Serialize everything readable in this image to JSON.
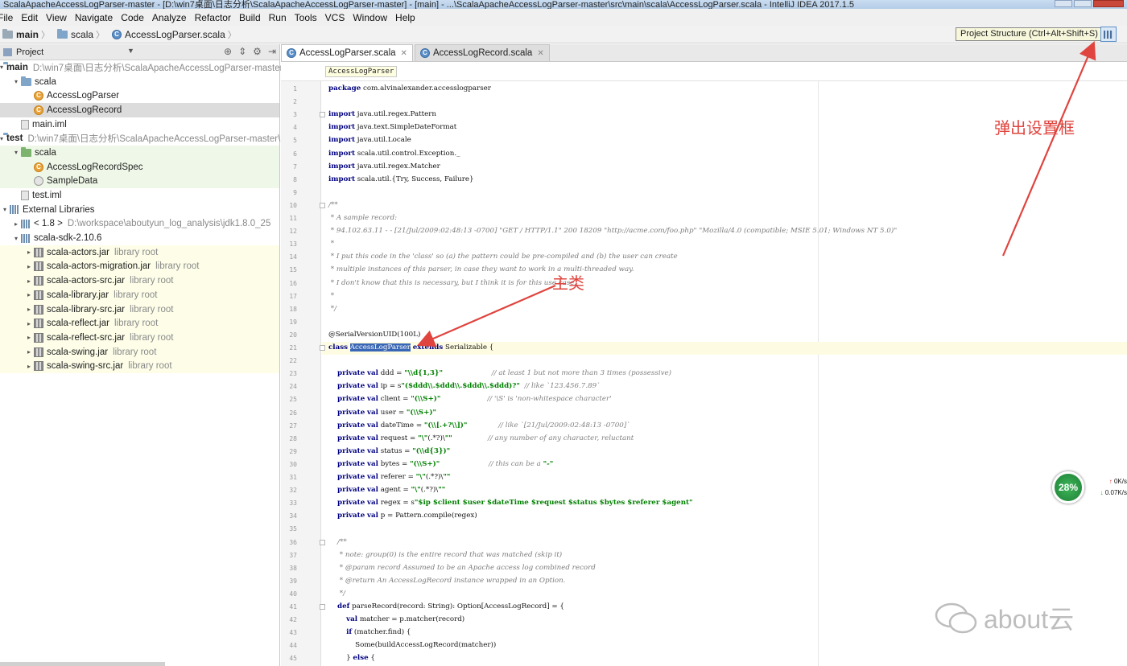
{
  "window": {
    "title": "ScalaApacheAccessLogParser-master - [D:\\win7桌面\\日志分析\\ScalaApacheAccessLogParser-master] - [main] - ...\\ScalaApacheAccessLogParser-master\\src\\main\\scala\\AccessLogParser.scala - IntelliJ IDEA 2017.1.5"
  },
  "menu": [
    "File",
    "Edit",
    "View",
    "Navigate",
    "Code",
    "Analyze",
    "Refactor",
    "Build",
    "Run",
    "Tools",
    "VCS",
    "Window",
    "Help"
  ],
  "nav": {
    "crumbs": [
      "main",
      "scala",
      "AccessLogParser.scala"
    ],
    "tooltip": "Project Structure (Ctrl+Alt+Shift+S)"
  },
  "project_panel": {
    "title": "Project",
    "tree": [
      {
        "label": "main",
        "hint": "D:\\win7桌面\\日志分析\\ScalaApacheAccessLogParser-master",
        "icon": "folder-icon",
        "bold": true,
        "arrow": "▾",
        "bg": ""
      },
      {
        "label": "scala",
        "hint": "",
        "icon": "folder-icon",
        "arrow": "▾",
        "bg": ""
      },
      {
        "label": "AccessLogParser",
        "hint": "",
        "icon": "scala-class-icon",
        "arrow": "",
        "bg": ""
      },
      {
        "label": "AccessLogRecord",
        "hint": "",
        "icon": "scala-class-icon",
        "arrow": "",
        "bg": "selected"
      },
      {
        "label": "main.iml",
        "hint": "",
        "icon": "iml-file-icon",
        "arrow": "",
        "bg": ""
      },
      {
        "label": "test",
        "hint": "D:\\win7桌面\\日志分析\\ScalaApacheAccessLogParser-master\\",
        "icon": "folder-icon",
        "bold": true,
        "arrow": "▾",
        "bg": ""
      },
      {
        "label": "scala",
        "hint": "",
        "icon": "test-folder-icon",
        "arrow": "▾",
        "bg": "green"
      },
      {
        "label": "AccessLogRecordSpec",
        "hint": "",
        "icon": "scala-class-icon",
        "arrow": "",
        "bg": "green"
      },
      {
        "label": "SampleData",
        "hint": "",
        "icon": "scala-object-icon",
        "arrow": "",
        "bg": "green"
      },
      {
        "label": "test.iml",
        "hint": "",
        "icon": "iml-file-icon",
        "arrow": "",
        "bg": ""
      },
      {
        "label": "External Libraries",
        "hint": "",
        "icon": "library-icon",
        "arrow": "▾",
        "bg": ""
      },
      {
        "label": "< 1.8 >",
        "hint": "D:\\workspace\\aboutyun_log_analysis\\jdk1.8.0_25",
        "icon": "jdk-icon",
        "arrow": "▸",
        "bg": ""
      },
      {
        "label": "scala-sdk-2.10.6",
        "hint": "",
        "icon": "library-icon",
        "arrow": "▾",
        "bg": ""
      },
      {
        "label": "scala-actors.jar",
        "hint": "library root",
        "icon": "jar-icon",
        "arrow": "▸",
        "bg": "yellow"
      },
      {
        "label": "scala-actors-migration.jar",
        "hint": "library root",
        "icon": "jar-icon",
        "arrow": "▸",
        "bg": "yellow"
      },
      {
        "label": "scala-actors-src.jar",
        "hint": "library root",
        "icon": "jar-icon",
        "arrow": "▸",
        "bg": "yellow"
      },
      {
        "label": "scala-library.jar",
        "hint": "library root",
        "icon": "jar-icon",
        "arrow": "▸",
        "bg": "yellow"
      },
      {
        "label": "scala-library-src.jar",
        "hint": "library root",
        "icon": "jar-icon",
        "arrow": "▸",
        "bg": "yellow"
      },
      {
        "label": "scala-reflect.jar",
        "hint": "library root",
        "icon": "jar-icon",
        "arrow": "▸",
        "bg": "yellow"
      },
      {
        "label": "scala-reflect-src.jar",
        "hint": "library root",
        "icon": "jar-icon",
        "arrow": "▸",
        "bg": "yellow"
      },
      {
        "label": "scala-swing.jar",
        "hint": "library root",
        "icon": "jar-icon",
        "arrow": "▸",
        "bg": "yellow"
      },
      {
        "label": "scala-swing-src.jar",
        "hint": "library root",
        "icon": "jar-icon",
        "arrow": "▸",
        "bg": "yellow"
      }
    ]
  },
  "editor": {
    "tabs": [
      {
        "label": "AccessLogParser.scala",
        "active": true
      },
      {
        "label": "AccessLogRecord.scala",
        "active": false
      }
    ],
    "breadcrumb": "AccessLogParser",
    "lines": [
      "package com.alvinalexander.accesslogparser",
      "",
      "import java.util.regex.Pattern",
      "import java.text.SimpleDateFormat",
      "import java.util.Locale",
      "import scala.util.control.Exception._",
      "import java.util.regex.Matcher",
      "import scala.util.{Try, Success, Failure}",
      "",
      "/**",
      " * A sample record:",
      " * 94.102.63.11 - - [21/Jul/2009:02:48:13 -0700] \"GET / HTTP/1.1\" 200 18209 \"http://acme.com/foo.php\" \"Mozilla/4.0 (compatible; MSIE 5.01; Windows NT 5.0)\"",
      " *",
      " * I put this code in the 'class' so (a) the pattern could be pre-compiled and (b) the user can create",
      " * multiple instances of this parser, in case they want to work in a multi-threaded way.",
      " * I don't know that this is necessary, but I think it is for this use case.",
      " *",
      " */",
      "",
      "@SerialVersionUID(100L)",
      "class AccessLogParser extends Serializable {",
      "",
      "    private val ddd = \"\\\\d{1,3}\"                      // at least 1 but not more than 3 times (possessive)",
      "    private val ip = s\"($ddd\\\\.$ddd\\\\.$ddd\\\\.$ddd)?\"  // like `123.456.7.89`",
      "    private val client = \"(\\\\S+)\"                     // '\\S' is 'non-whitespace character'",
      "    private val user = \"(\\\\S+)\"",
      "    private val dateTime = \"(\\\\[.+?\\\\])\"              // like `[21/Jul/2009:02:48:13 -0700]`",
      "    private val request = \"\\\"(.*?)\\\"\"                // any number of any character, reluctant",
      "    private val status = \"(\\\\d{3})\"",
      "    private val bytes = \"(\\\\S+)\"                      // this can be a \"-\"",
      "    private val referer = \"\\\"(.*?)\\\"\"",
      "    private val agent = \"\\\"(.*?)\\\"\"",
      "    private val regex = s\"$ip $client $user $dateTime $request $status $bytes $referer $agent\"",
      "    private val p = Pattern.compile(regex)",
      "",
      "    /**",
      "     * note: group(0) is the entire record that was matched (skip it)",
      "     * @param record Assumed to be an Apache access log combined record",
      "     * @return An AccessLogRecord instance wrapped in an Option.",
      "     */",
      "    def parseRecord(record: String): Option[AccessLogRecord] = {",
      "        val matcher = p.matcher(record)",
      "        if (matcher.find) {",
      "            Some(buildAccessLogRecord(matcher))",
      "        } else {"
    ]
  },
  "annotations": {
    "popup_settings": "弹出设置框",
    "main_class": "主类"
  },
  "net_widget": {
    "percent": "28%",
    "up": "0K/s",
    "down": "0.07K/s"
  },
  "watermark": "about云",
  "colors": {
    "annotation": "#e0443e",
    "keyword": "#000080",
    "string": "#008000"
  }
}
